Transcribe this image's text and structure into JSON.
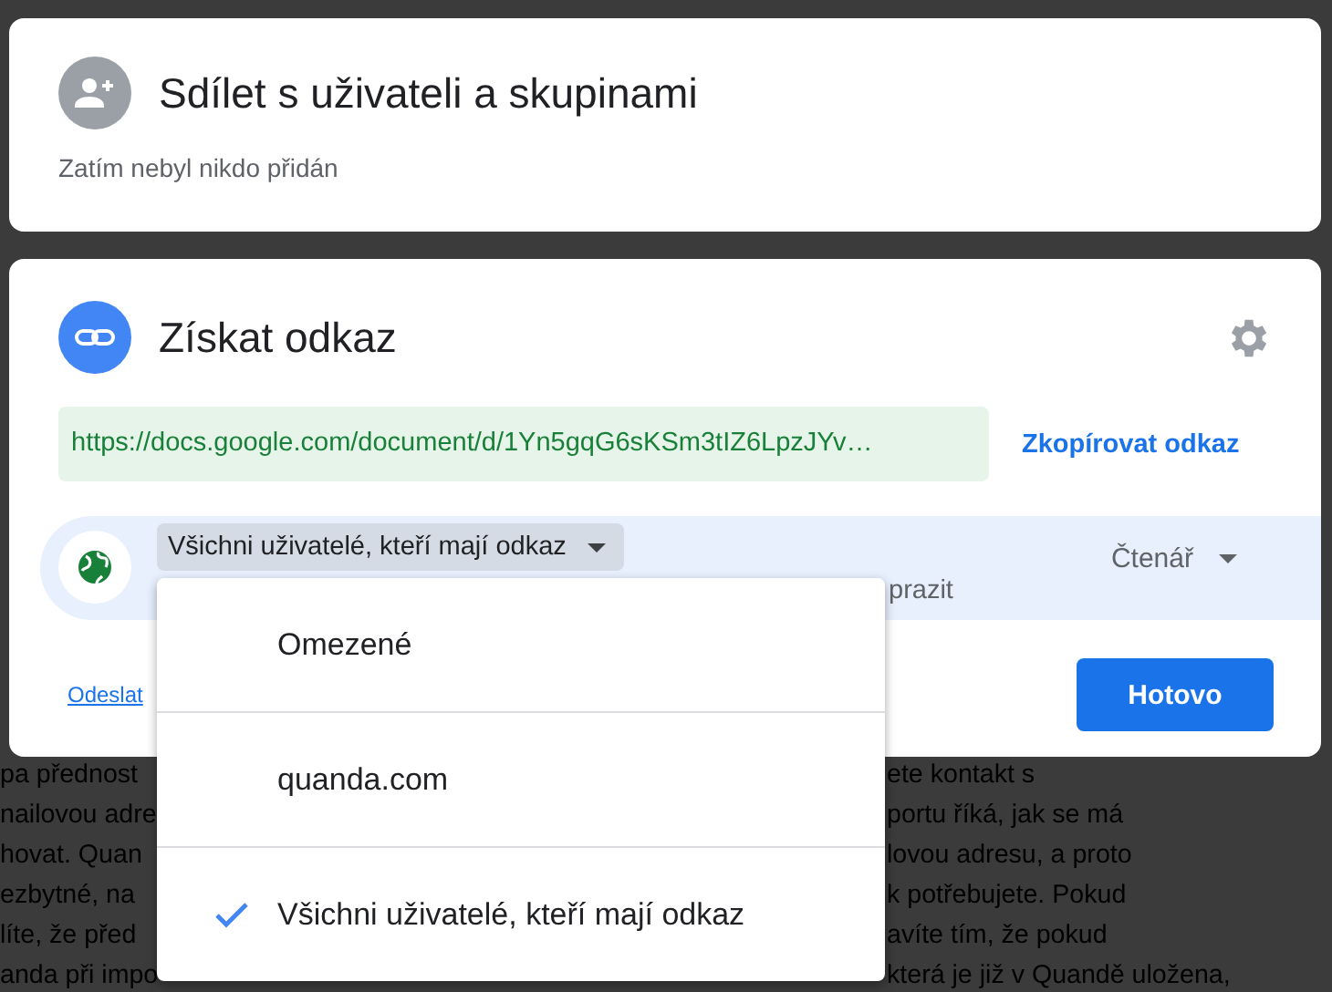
{
  "document": {
    "lines": [
      {
        "left": "pa přednost",
        "right": "ete kontakt s"
      },
      {
        "left": "nailovou adre",
        "right": "portu říká, jak se má"
      },
      {
        "left": "hovat. Quan",
        "right": "lovou adresu, a proto"
      },
      {
        "left": "ezbytné, na",
        "right": "k potřebujete. Pokud"
      },
      {
        "left": "líte, že před",
        "right": "avíte tím, že pokud"
      },
      {
        "left": "anda při impo",
        "right": "která je již v Quandě uložena,"
      }
    ]
  },
  "share_people": {
    "title": "Sdílet s uživateli a skupinami",
    "status": "Zatím nebyl nikdo přidán"
  },
  "get_link": {
    "title": "Získat odkaz",
    "url": "https://docs.google.com/document/d/1Yn5gqG6sKSm3tIZ6LpzJYv…",
    "copy_link": "Zkopírovat odkaz",
    "access": {
      "scope": "Všichni uživatelé, kteří mají odkaz",
      "description": "prazit",
      "role": "Čtenář"
    },
    "feedback_link": "Odeslat",
    "done_button": "Hotovo"
  },
  "access_menu": {
    "options": [
      {
        "label": "Omezené",
        "selected": false
      },
      {
        "label": "quanda.com",
        "selected": false
      },
      {
        "label": "Všichni uživatelé, kteří mají odkaz",
        "selected": true
      }
    ]
  }
}
